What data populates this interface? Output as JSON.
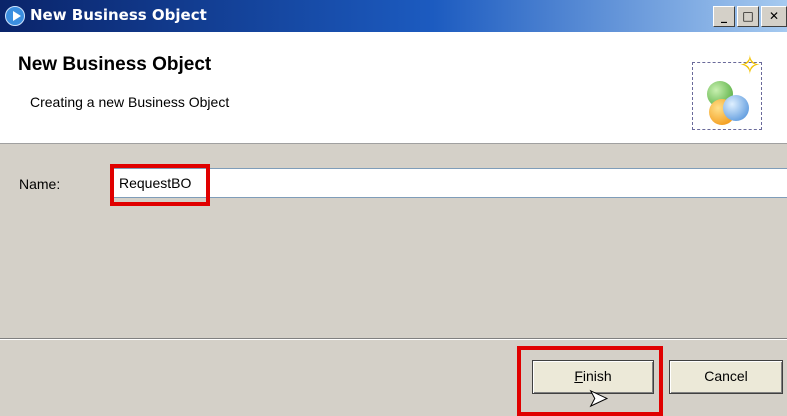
{
  "window": {
    "title": "New Business Object",
    "min_glyph": "_",
    "max_glyph": "□",
    "close_glyph": "✕"
  },
  "header": {
    "title": "New Business Object",
    "description": "Creating a new Business Object"
  },
  "form": {
    "name_label": "Name:",
    "name_value": "RequestBO"
  },
  "buttons": {
    "finish_mnemonic": "F",
    "finish_rest": "inish",
    "cancel_label": "Cancel"
  },
  "icons": {
    "app": "eclipse-app-icon",
    "wizard": "business-object-wizard-icon",
    "cursor": "mouse-pointer-icon"
  },
  "colors": {
    "titlebar": "#0a246a",
    "highlight": "#e00000"
  }
}
